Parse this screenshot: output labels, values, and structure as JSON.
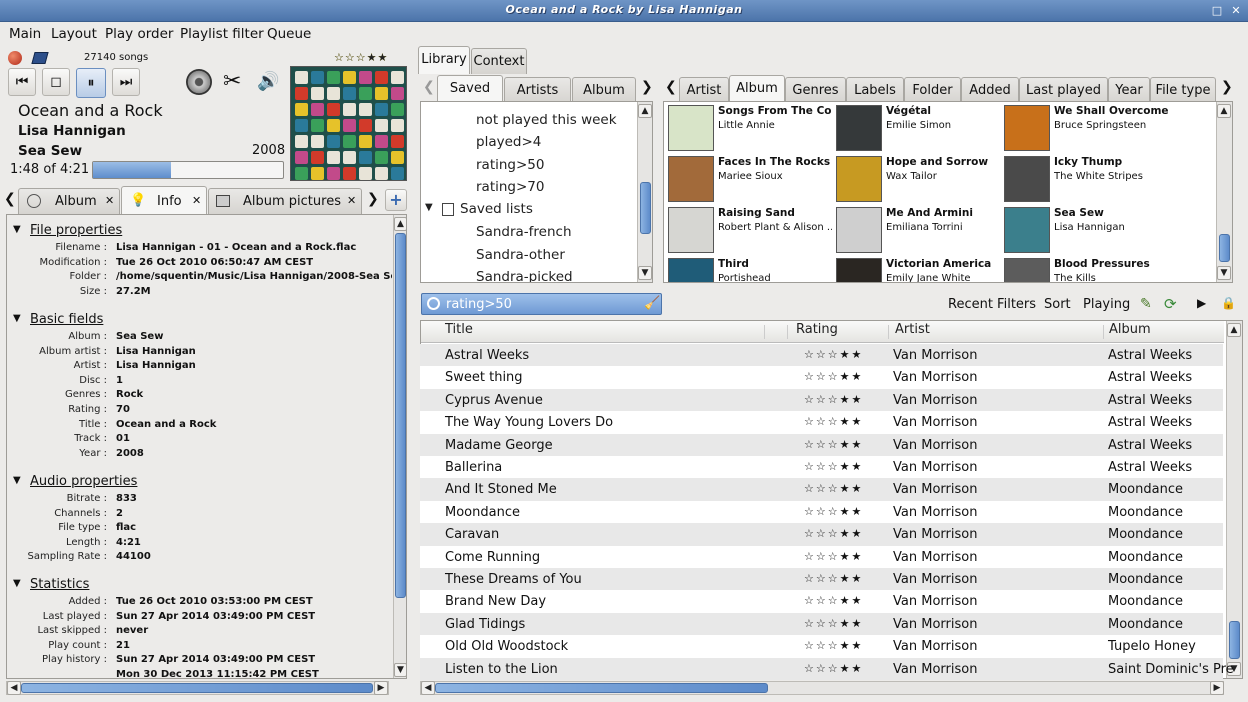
{
  "window": {
    "title": "Ocean and a Rock by Lisa Hannigan"
  },
  "menu": [
    "Main",
    "Layout",
    "Play order",
    "Playlist filter",
    "Queue"
  ],
  "player": {
    "song_count": "27140 songs",
    "title": "Ocean and a Rock",
    "artist": "Lisa Hannigan",
    "album": "Sea Sew",
    "year": "2008",
    "position": "1:48 of 4:21",
    "progress": 0.41,
    "rating_stars": "☆☆☆★★"
  },
  "left_tabs": [
    {
      "label": "Album",
      "icon": "disc-icon"
    },
    {
      "label": "Info",
      "icon": "bulb-icon"
    },
    {
      "label": "Album pictures",
      "icon": "picture-icon"
    }
  ],
  "info": {
    "sections": [
      {
        "title": "File properties",
        "fields": [
          [
            "Filename :",
            "Lisa Hannigan - 01 - Ocean and a Rock.flac"
          ],
          [
            "Modification :",
            "Tue 26 Oct 2010 06:50:47 AM CEST"
          ],
          [
            "Folder :",
            "/home/squentin/Music/Lisa Hannigan/2008-Sea Se"
          ],
          [
            "Size :",
            "27.2M"
          ]
        ]
      },
      {
        "title": "Basic fields",
        "fields": [
          [
            "Album :",
            "Sea Sew"
          ],
          [
            "Album artist :",
            "Lisa Hannigan"
          ],
          [
            "Artist :",
            "Lisa Hannigan"
          ],
          [
            "Disc :",
            "1"
          ],
          [
            "Genres :",
            "Rock"
          ],
          [
            "Rating :",
            "70"
          ],
          [
            "Title :",
            "Ocean and a Rock"
          ],
          [
            "Track :",
            "01"
          ],
          [
            "Year :",
            "2008"
          ]
        ]
      },
      {
        "title": "Audio properties",
        "fields": [
          [
            "Bitrate :",
            "833"
          ],
          [
            "Channels :",
            "2"
          ],
          [
            "File type :",
            "flac"
          ],
          [
            "Length :",
            "4:21"
          ],
          [
            "Sampling Rate :",
            "44100"
          ]
        ]
      },
      {
        "title": "Statistics",
        "fields": [
          [
            "Added :",
            "Tue 26 Oct 2010 03:53:00 PM CEST"
          ],
          [
            "Last played :",
            "Sun 27 Apr 2014 03:49:00 PM CEST"
          ],
          [
            "Last skipped :",
            "never"
          ],
          [
            "Play count :",
            "21"
          ],
          [
            "Play history :",
            "Sun 27 Apr 2014 03:49:00 PM CEST"
          ],
          [
            "",
            "Mon 30 Dec 2013 11:15:42 PM CEST"
          ]
        ]
      }
    ]
  },
  "library_tabs": [
    "Library",
    "Context"
  ],
  "saved_tabs": [
    "Saved",
    "Artists",
    "Album"
  ],
  "saved_tree": {
    "items": [
      "not played this week",
      "played>4",
      "rating>50",
      "rating>70"
    ],
    "group": "Saved lists",
    "sub_items": [
      "Sandra-french",
      "Sandra-other",
      "Sandra-picked"
    ]
  },
  "browse_tabs": [
    "Artist",
    "Album",
    "Genres",
    "Labels",
    "Folder",
    "Added",
    "Last played",
    "Year",
    "File type"
  ],
  "albums": [
    {
      "title": "Songs From The Co...",
      "artist": "Little Annie",
      "color": "#d8e4c8"
    },
    {
      "title": "Végétal",
      "artist": "Emilie Simon",
      "color": "#35393a"
    },
    {
      "title": "We Shall Overcome...",
      "artist": "Bruce Springsteen",
      "color": "#c8701a"
    },
    {
      "title": "Faces In The Rocks",
      "artist": "Mariee Sioux",
      "color": "#a26a3a"
    },
    {
      "title": "Hope and Sorrow",
      "artist": "Wax Tailor",
      "color": "#c79a22"
    },
    {
      "title": "Icky Thump",
      "artist": "The White Stripes",
      "color": "#4a4a4a"
    },
    {
      "title": "Raising Sand",
      "artist": "Robert Plant & Alison ...",
      "color": "#d6d6d2"
    },
    {
      "title": "Me And Armini",
      "artist": "Emiliana Torrini",
      "color": "#cfcfcf"
    },
    {
      "title": "Sea Sew",
      "artist": "Lisa Hannigan",
      "color": "#3b7f8c"
    },
    {
      "title": "Third",
      "artist": "Portishead",
      "color": "#1f5c78"
    },
    {
      "title": "Victorian America",
      "artist": "Emily Jane White",
      "color": "#2a2622"
    },
    {
      "title": "Blood Pressures",
      "artist": "The Kills",
      "color": "#5c5c5c"
    }
  ],
  "filter": {
    "value": "rating>50",
    "recent_label": "Recent Filters",
    "sort_label": "Sort",
    "playing_label": "Playing"
  },
  "columns": [
    "Title",
    "Rating",
    "Artist",
    "Album"
  ],
  "tracks": [
    {
      "title": "Astral Weeks",
      "rating": "☆☆☆★★",
      "artist": "Van Morrison",
      "album": "Astral Weeks"
    },
    {
      "title": "Sweet thing",
      "rating": "☆☆☆★★",
      "artist": "Van Morrison",
      "album": "Astral Weeks"
    },
    {
      "title": "Cyprus Avenue",
      "rating": "☆☆☆★★",
      "artist": "Van Morrison",
      "album": "Astral Weeks"
    },
    {
      "title": "The Way Young Lovers Do",
      "rating": "☆☆☆★★",
      "artist": "Van Morrison",
      "album": "Astral Weeks"
    },
    {
      "title": "Madame George",
      "rating": "☆☆☆★★",
      "artist": "Van Morrison",
      "album": "Astral Weeks"
    },
    {
      "title": "Ballerina",
      "rating": "☆☆☆★★",
      "artist": "Van Morrison",
      "album": "Astral Weeks"
    },
    {
      "title": "And It Stoned Me",
      "rating": "☆☆☆★★",
      "artist": "Van Morrison",
      "album": "Moondance"
    },
    {
      "title": "Moondance",
      "rating": "☆☆☆★★",
      "artist": "Van Morrison",
      "album": "Moondance"
    },
    {
      "title": "Caravan",
      "rating": "☆☆☆★★",
      "artist": "Van Morrison",
      "album": "Moondance"
    },
    {
      "title": "Come Running",
      "rating": "☆☆☆★★",
      "artist": "Van Morrison",
      "album": "Moondance"
    },
    {
      "title": "These Dreams of You",
      "rating": "☆☆☆★★",
      "artist": "Van Morrison",
      "album": "Moondance"
    },
    {
      "title": "Brand New Day",
      "rating": "☆☆☆★★",
      "artist": "Van Morrison",
      "album": "Moondance"
    },
    {
      "title": "Glad Tidings",
      "rating": "☆☆☆★★",
      "artist": "Van Morrison",
      "album": "Moondance"
    },
    {
      "title": "Old Old Woodstock",
      "rating": "☆☆☆★★",
      "artist": "Van Morrison",
      "album": "Tupelo Honey"
    },
    {
      "title": "Listen to the Lion",
      "rating": "☆☆☆★★",
      "artist": "Van Morrison",
      "album": "Saint Dominic's Pre"
    }
  ],
  "colors": {
    "accent": "#4c74aa",
    "star": "#f2e24a",
    "row_alt": "#e8e8e8"
  }
}
